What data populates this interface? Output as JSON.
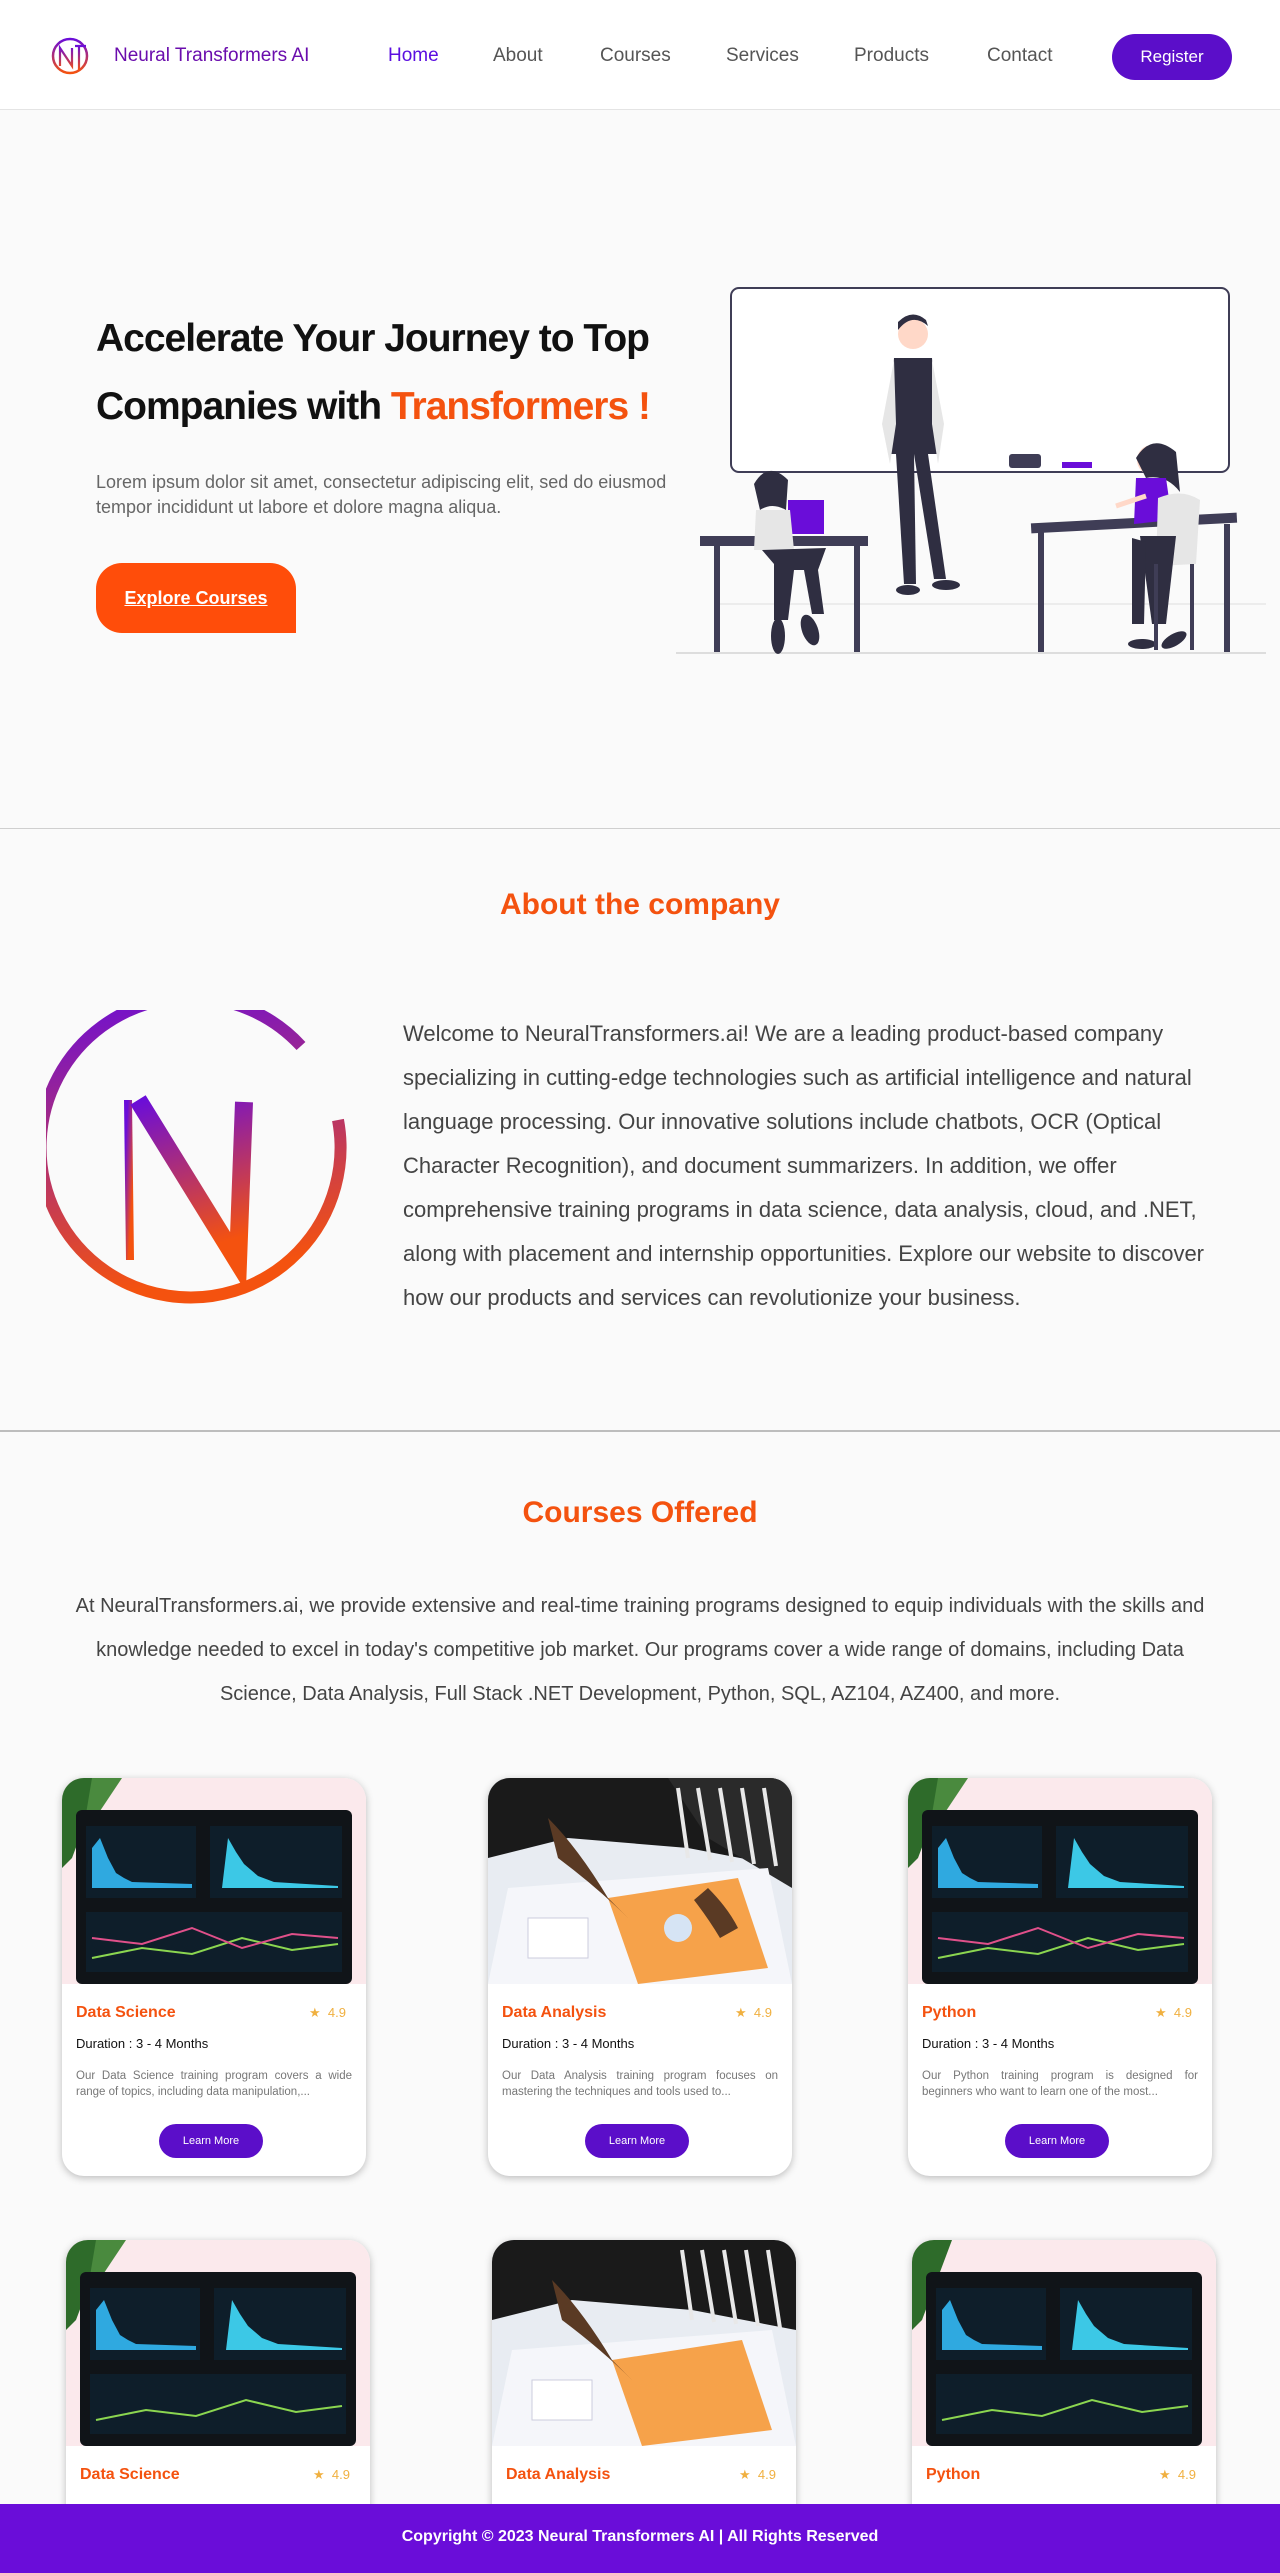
{
  "nav": {
    "brand": "Neural Transformers AI",
    "links": [
      "Home",
      "About",
      "Courses",
      "Services",
      "Products",
      "Contact"
    ],
    "register_label": "Register"
  },
  "hero": {
    "title_part1": "Accelerate Your Journey to Top Companies with ",
    "title_accent": "Transformers !",
    "subtitle": "Lorem ipsum dolor sit amet, consectetur adipiscing elit, sed do eiusmod tempor incididunt ut labore et dolore magna aliqua.",
    "cta_label": "Explore Courses"
  },
  "about": {
    "title": "About the company",
    "text": "Welcome to NeuralTransformers.ai! We are a leading product-based company specializing in cutting-edge technologies such as artificial intelligence and natural language processing. Our innovative solutions include chatbots, OCR (Optical Character Recognition), and document summarizers. In addition, we offer comprehensive training programs in data science, data analysis, cloud, and .NET, along with placement and internship opportunities. Explore our website to discover how our products and services can revolutionize your business."
  },
  "courses": {
    "title": "Courses Offered",
    "intro": "At NeuralTransformers.ai, we provide extensive and real-time training programs designed to equip individuals with the skills and knowledge needed to excel in today's competitive job market. Our programs cover a wide range of domains, including Data Science, Data Analysis, Full Stack .NET Development, Python, SQL, AZ104, AZ400, and more.",
    "cards": [
      {
        "title": "Data Science",
        "rating": "4.9",
        "duration": "Duration : 3 - 4 Months",
        "desc": "Our Data Science training program covers a wide range of topics, including data manipulation,...",
        "button": "Learn More",
        "image": "dashboard"
      },
      {
        "title": "Data Analysis",
        "rating": "4.9",
        "duration": "Duration : 3 - 4 Months",
        "desc": "Our Data Analysis training program focuses on mastering the techniques and tools used to...",
        "button": "Learn More",
        "image": "paperwork"
      },
      {
        "title": "Python",
        "rating": "4.9",
        "duration": "Duration : 3 - 4 Months",
        "desc": "Our Python training program is designed for beginners who want to learn one of the most...",
        "button": "Learn More",
        "image": "dashboard"
      },
      {
        "title": "Data Science",
        "rating": "4.9",
        "duration": "",
        "desc": "",
        "button": "",
        "image": "dashboard"
      },
      {
        "title": "Data Analysis",
        "rating": "4.9",
        "duration": "",
        "desc": "",
        "button": "",
        "image": "paperwork"
      },
      {
        "title": "Python",
        "rating": "4.9",
        "duration": "",
        "desc": "",
        "button": "",
        "image": "dashboard"
      }
    ]
  },
  "footer": {
    "text": "Copyright © 2023 Neural Transformers AI | All Rights Reserved"
  },
  "colors": {
    "brand_purple": "#5b0ec9",
    "accent_orange": "#f4520f",
    "footer_purple": "#6a0dd9"
  }
}
